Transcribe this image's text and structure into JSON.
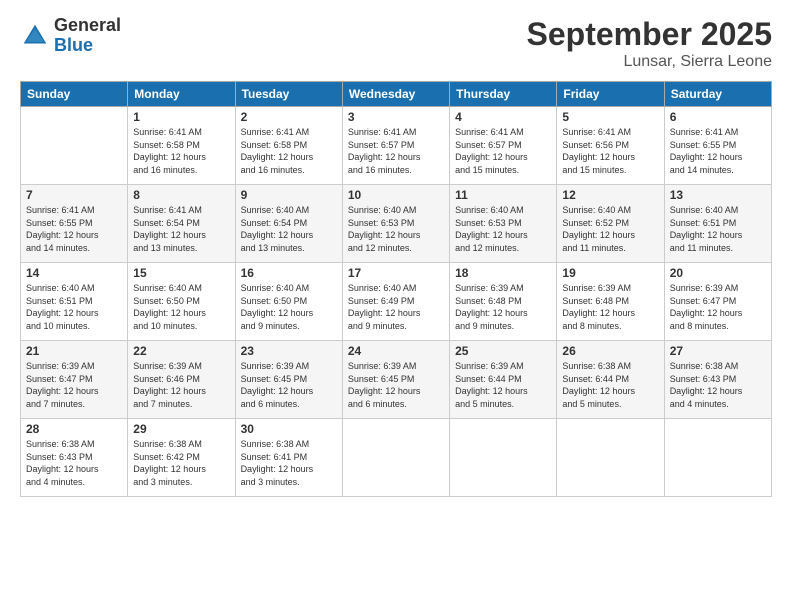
{
  "logo": {
    "general": "General",
    "blue": "Blue"
  },
  "title": "September 2025",
  "location": "Lunsar, Sierra Leone",
  "days_of_week": [
    "Sunday",
    "Monday",
    "Tuesday",
    "Wednesday",
    "Thursday",
    "Friday",
    "Saturday"
  ],
  "weeks": [
    [
      {
        "day": "",
        "info": ""
      },
      {
        "day": "1",
        "info": "Sunrise: 6:41 AM\nSunset: 6:58 PM\nDaylight: 12 hours\nand 16 minutes."
      },
      {
        "day": "2",
        "info": "Sunrise: 6:41 AM\nSunset: 6:58 PM\nDaylight: 12 hours\nand 16 minutes."
      },
      {
        "day": "3",
        "info": "Sunrise: 6:41 AM\nSunset: 6:57 PM\nDaylight: 12 hours\nand 16 minutes."
      },
      {
        "day": "4",
        "info": "Sunrise: 6:41 AM\nSunset: 6:57 PM\nDaylight: 12 hours\nand 15 minutes."
      },
      {
        "day": "5",
        "info": "Sunrise: 6:41 AM\nSunset: 6:56 PM\nDaylight: 12 hours\nand 15 minutes."
      },
      {
        "day": "6",
        "info": "Sunrise: 6:41 AM\nSunset: 6:55 PM\nDaylight: 12 hours\nand 14 minutes."
      }
    ],
    [
      {
        "day": "7",
        "info": "Sunrise: 6:41 AM\nSunset: 6:55 PM\nDaylight: 12 hours\nand 14 minutes."
      },
      {
        "day": "8",
        "info": "Sunrise: 6:41 AM\nSunset: 6:54 PM\nDaylight: 12 hours\nand 13 minutes."
      },
      {
        "day": "9",
        "info": "Sunrise: 6:40 AM\nSunset: 6:54 PM\nDaylight: 12 hours\nand 13 minutes."
      },
      {
        "day": "10",
        "info": "Sunrise: 6:40 AM\nSunset: 6:53 PM\nDaylight: 12 hours\nand 12 minutes."
      },
      {
        "day": "11",
        "info": "Sunrise: 6:40 AM\nSunset: 6:53 PM\nDaylight: 12 hours\nand 12 minutes."
      },
      {
        "day": "12",
        "info": "Sunrise: 6:40 AM\nSunset: 6:52 PM\nDaylight: 12 hours\nand 11 minutes."
      },
      {
        "day": "13",
        "info": "Sunrise: 6:40 AM\nSunset: 6:51 PM\nDaylight: 12 hours\nand 11 minutes."
      }
    ],
    [
      {
        "day": "14",
        "info": "Sunrise: 6:40 AM\nSunset: 6:51 PM\nDaylight: 12 hours\nand 10 minutes."
      },
      {
        "day": "15",
        "info": "Sunrise: 6:40 AM\nSunset: 6:50 PM\nDaylight: 12 hours\nand 10 minutes."
      },
      {
        "day": "16",
        "info": "Sunrise: 6:40 AM\nSunset: 6:50 PM\nDaylight: 12 hours\nand 9 minutes."
      },
      {
        "day": "17",
        "info": "Sunrise: 6:40 AM\nSunset: 6:49 PM\nDaylight: 12 hours\nand 9 minutes."
      },
      {
        "day": "18",
        "info": "Sunrise: 6:39 AM\nSunset: 6:48 PM\nDaylight: 12 hours\nand 9 minutes."
      },
      {
        "day": "19",
        "info": "Sunrise: 6:39 AM\nSunset: 6:48 PM\nDaylight: 12 hours\nand 8 minutes."
      },
      {
        "day": "20",
        "info": "Sunrise: 6:39 AM\nSunset: 6:47 PM\nDaylight: 12 hours\nand 8 minutes."
      }
    ],
    [
      {
        "day": "21",
        "info": "Sunrise: 6:39 AM\nSunset: 6:47 PM\nDaylight: 12 hours\nand 7 minutes."
      },
      {
        "day": "22",
        "info": "Sunrise: 6:39 AM\nSunset: 6:46 PM\nDaylight: 12 hours\nand 7 minutes."
      },
      {
        "day": "23",
        "info": "Sunrise: 6:39 AM\nSunset: 6:45 PM\nDaylight: 12 hours\nand 6 minutes."
      },
      {
        "day": "24",
        "info": "Sunrise: 6:39 AM\nSunset: 6:45 PM\nDaylight: 12 hours\nand 6 minutes."
      },
      {
        "day": "25",
        "info": "Sunrise: 6:39 AM\nSunset: 6:44 PM\nDaylight: 12 hours\nand 5 minutes."
      },
      {
        "day": "26",
        "info": "Sunrise: 6:38 AM\nSunset: 6:44 PM\nDaylight: 12 hours\nand 5 minutes."
      },
      {
        "day": "27",
        "info": "Sunrise: 6:38 AM\nSunset: 6:43 PM\nDaylight: 12 hours\nand 4 minutes."
      }
    ],
    [
      {
        "day": "28",
        "info": "Sunrise: 6:38 AM\nSunset: 6:43 PM\nDaylight: 12 hours\nand 4 minutes."
      },
      {
        "day": "29",
        "info": "Sunrise: 6:38 AM\nSunset: 6:42 PM\nDaylight: 12 hours\nand 3 minutes."
      },
      {
        "day": "30",
        "info": "Sunrise: 6:38 AM\nSunset: 6:41 PM\nDaylight: 12 hours\nand 3 minutes."
      },
      {
        "day": "",
        "info": ""
      },
      {
        "day": "",
        "info": ""
      },
      {
        "day": "",
        "info": ""
      },
      {
        "day": "",
        "info": ""
      }
    ]
  ]
}
